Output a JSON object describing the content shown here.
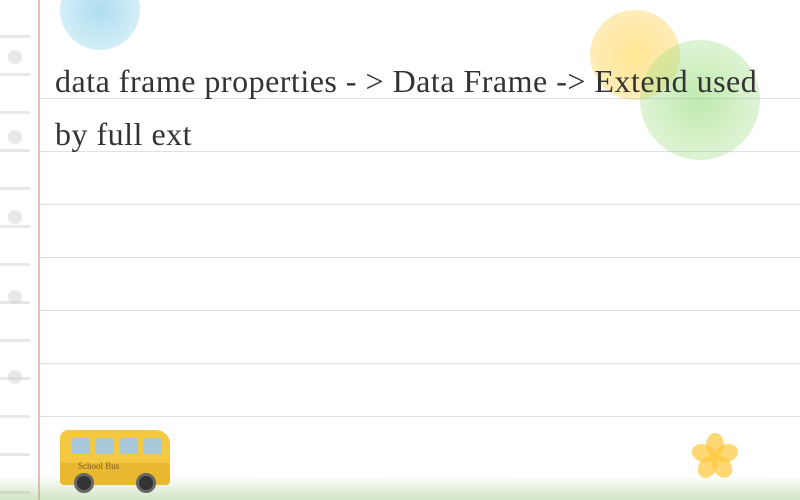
{
  "main_text": "data frame properties - > Data Frame -> Extend used by full ext",
  "bus_label": "School Bus"
}
